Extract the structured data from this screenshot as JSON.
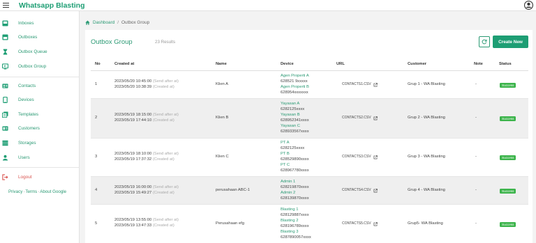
{
  "app": {
    "title": "Whatsapp Blasting"
  },
  "sidebar": {
    "items": [
      {
        "label": "Inboxes",
        "icon": "inbox-icon"
      },
      {
        "label": "Outboxes",
        "icon": "outbox-icon"
      },
      {
        "label": "Outbox Queue",
        "icon": "hourglass-icon"
      },
      {
        "label": "Outbox Group",
        "icon": "monitor-icon"
      },
      {
        "label": "Contacts",
        "icon": "contact-card-icon"
      },
      {
        "label": "Devices",
        "icon": "phone-icon"
      },
      {
        "label": "Templates",
        "icon": "template-icon"
      },
      {
        "label": "Customers",
        "icon": "id-card-icon"
      },
      {
        "label": "Storages",
        "icon": "storage-icon"
      },
      {
        "label": "Users",
        "icon": "user-icon"
      }
    ],
    "logout": {
      "label": "Logout",
      "icon": "logout-icon",
      "color": "#d9534f"
    },
    "footer": {
      "privacy": "Privacy",
      "terms": "Terms",
      "about": "About Google",
      "sep": "·"
    }
  },
  "breadcrumb": {
    "home": "Dashboard",
    "sep": "/",
    "current": "Outbox Group"
  },
  "page": {
    "title": "Outbox Group",
    "count": "23 Results",
    "create_label": "Create New"
  },
  "table": {
    "headers": {
      "no": "No",
      "created": "Created at",
      "name": "Name",
      "device": "Device",
      "url": "URL",
      "customer": "Customer",
      "note": "Note",
      "status": "Status"
    },
    "rows": [
      {
        "no": "1",
        "send_time": "2023/05/20 10:45:00",
        "send_label": "(Send after at)",
        "created_time": "2023/05/20 10:38:39",
        "created_label": "(Created at)",
        "name": "Klien A",
        "devices": [
          "Agen Properti A",
          "628521 9xxxxx",
          "Agen Properti B",
          "628954xxxxxxx"
        ],
        "url": "CONTACTS1.CSV",
        "customer": "Grup 1 - WA Blasting",
        "note": "-",
        "status": "Success"
      },
      {
        "no": "2",
        "send_time": "2023/05/19 18:15:00",
        "send_label": "(Send after at)",
        "created_time": "2023/05/19 17:44:10",
        "created_label": "(Created at)",
        "name": "Klien B",
        "devices": [
          "Yayasan A",
          "6282125xxxx",
          "Yayasan B",
          "628952341xxxx",
          "Yayasan C",
          "628933567xxxx"
        ],
        "url": "CONTACTS2.CSV",
        "customer": "Grup 2 - WA Blasting",
        "note": "-",
        "status": "Success"
      },
      {
        "no": "3",
        "send_time": "2023/05/19 18:10:00",
        "send_label": "(Send after at)",
        "created_time": "2023/05/19 17:37:32",
        "created_label": "(Created at)",
        "name": "Klien C",
        "devices": [
          "PT A",
          "6282125xxxx",
          "PT B",
          "628529890xxxx",
          "PT C",
          "628967780xxxx"
        ],
        "url": "CONTACTS3.CSV",
        "customer": "Grup 3 - WA Blasting",
        "note": "-",
        "status": "Success"
      },
      {
        "no": "4",
        "send_time": "2023/05/19 16:00:00",
        "send_label": "(Send after at)",
        "created_time": "2023/05/19 15:49:27",
        "created_label": "(Created at)",
        "name": "perusahaan ABC-1",
        "devices": [
          "Admin 1",
          "628219870xxxx",
          "Admin 2",
          "628139870xxxx"
        ],
        "url": "CONTACTS4.CSV",
        "customer": "Grup 4 - WA Blasting",
        "note": "-",
        "status": "Success"
      },
      {
        "no": "5",
        "send_time": "2023/05/19 13:55:00",
        "send_label": "(Send after at)",
        "created_time": "2023/05/19 13:47:33",
        "created_label": "(Created at)",
        "name": "Perusahaan efg",
        "devices": [
          "Blasting 1",
          "628129887xxxx",
          "Blasting 2",
          "628196789xxxx",
          "Blasting 3",
          "6287890057xxxx"
        ],
        "url": "CONTACTS5.CSV",
        "customer": "Grup5- WA Blasting",
        "note": "-",
        "status": "Success"
      }
    ]
  },
  "colors": {
    "brand": "#1e9e74",
    "link": "#2b9a74",
    "success": "#3cb44b",
    "shade": "#efefef"
  }
}
